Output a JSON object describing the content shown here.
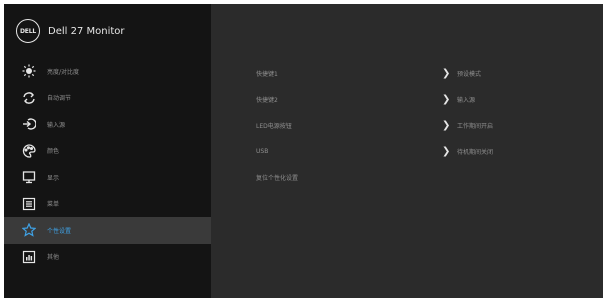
{
  "header": {
    "logo_text": "DELL",
    "title": "Dell 27 Monitor"
  },
  "sidebar": {
    "items": [
      {
        "label": "亮度/对比度",
        "icon": "brightness-icon"
      },
      {
        "label": "自动调节",
        "icon": "auto-adjust-icon"
      },
      {
        "label": "输入源",
        "icon": "input-source-icon"
      },
      {
        "label": "颜色",
        "icon": "color-icon"
      },
      {
        "label": "显示",
        "icon": "display-icon"
      },
      {
        "label": "菜单",
        "icon": "menu-icon"
      },
      {
        "label": "个性设置",
        "icon": "star-icon",
        "active": true
      },
      {
        "label": "其他",
        "icon": "others-icon"
      }
    ]
  },
  "main": {
    "rows": [
      {
        "label": "快捷键1",
        "value": "预设模式"
      },
      {
        "label": "快捷键2",
        "value": "输入源"
      },
      {
        "label": "LED电源按钮",
        "value": "工作期间开启"
      },
      {
        "label": "USB",
        "value": "待机期间关闭"
      },
      {
        "label": "复位个性化设置",
        "value": ""
      }
    ]
  },
  "colors": {
    "accent": "#3fa2e6",
    "sidebar_bg": "#141414",
    "panel_bg": "#2b2b2b",
    "text": "#8f8f8f"
  }
}
